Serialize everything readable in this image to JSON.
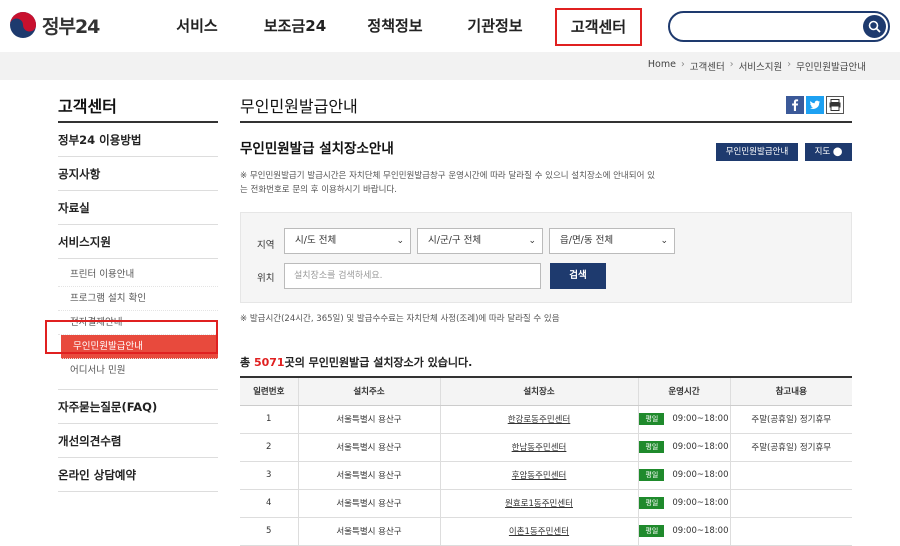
{
  "header": {
    "logo_text": "정부24",
    "nav": [
      "서비스",
      "보조금24",
      "정책정보",
      "기관정보",
      "고객센터"
    ],
    "search_placeholder": ""
  },
  "breadcrumb": [
    "Home",
    "고객센터",
    "서비스지원",
    "무인민원발급안내"
  ],
  "sidebar": {
    "title": "고객센터",
    "items": [
      "정부24 이용방법",
      "공지사항",
      "자료실",
      "서비스지원"
    ],
    "sub_items": [
      "프린터 이용안내",
      "프로그램 설치 확인",
      "전자결제안내",
      "무인민원발급안내",
      "어디서나 민원"
    ],
    "items_after": [
      "자주묻는질문(FAQ)",
      "개선의견수렴",
      "온라인 상담예약"
    ]
  },
  "main": {
    "page_title": "무인민원발급안내",
    "sub_title": "무인민원발급 설치장소안내",
    "btn_guide": "무인민원발급안내",
    "btn_map": "지도",
    "note1": "※ 무인민원발급기 발급시간은 자치단체 무인민원발급창구 운영시간에 따라 달라질 수 있으니 설치장소에 안내되어 있는 전화번호로 문의 후 이용하시기 바랍니다.",
    "filter": {
      "region_label": "지역",
      "location_label": "위치",
      "sel1": "시/도 전체",
      "sel2": "시/군/구 전체",
      "sel3": "읍/면/동 전체",
      "input_placeholder": "설치장소를 검색하세요.",
      "search_btn": "검색"
    },
    "note2": "※ 발급시간(24시간, 365일) 및 발급수수료는 자치단체 사정(조례)에 따라 달라질 수 있음",
    "count_prefix": "총 ",
    "count_num": "5071",
    "count_suffix": "곳의 무인민원발급 설치장소가 있습니다."
  },
  "table": {
    "headers": [
      "일련번호",
      "설치주소",
      "설치장소",
      "운영시간",
      "참고내용"
    ],
    "rows": [
      {
        "no": "1",
        "addr": "서울특별시 용산구",
        "place": "한강로동주민센터",
        "badge": "평일",
        "time": "09:00~18:00",
        "note": "주말(공휴일) 정기휴무"
      },
      {
        "no": "2",
        "addr": "서울특별시 용산구",
        "place": "한남동주민센터",
        "badge": "평일",
        "time": "09:00~18:00",
        "note": "주말(공휴일) 정기휴무"
      },
      {
        "no": "3",
        "addr": "서울특별시 용산구",
        "place": "후암동주민센터",
        "badge": "평일",
        "time": "09:00~18:00",
        "note": ""
      },
      {
        "no": "4",
        "addr": "서울특별시 용산구",
        "place": "원효로1동주민센터",
        "badge": "평일",
        "time": "09:00~18:00",
        "note": ""
      },
      {
        "no": "5",
        "addr": "서울특별시 용산구",
        "place": "이촌1동주민센터",
        "badge": "평일",
        "time": "09:00~18:00",
        "note": ""
      }
    ]
  }
}
